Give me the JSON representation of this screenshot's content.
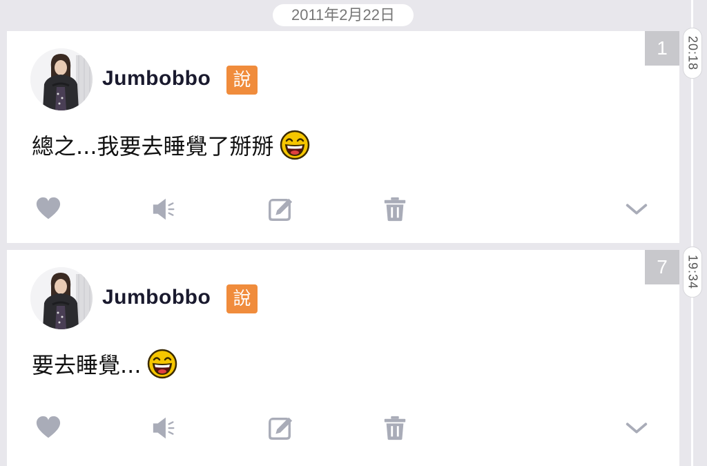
{
  "date_label": "2011年2月22日",
  "posts": [
    {
      "time": "20:18",
      "response_count": "1",
      "username": "Jumbobbo",
      "qualifier": "說",
      "text": "總之...我要去睡覺了掰掰",
      "emoji_icon": "grinning-face-emoji",
      "actions": [
        "heart-icon",
        "mute-icon",
        "edit-icon",
        "trash-icon",
        "chevron-down-icon"
      ]
    },
    {
      "time": "19:34",
      "response_count": "7",
      "username": "Jumbobbo",
      "qualifier": "說",
      "text": "要去睡覺...",
      "emoji_icon": "grinning-face-emoji",
      "actions": [
        "heart-icon",
        "mute-icon",
        "edit-icon",
        "trash-icon",
        "chevron-down-icon"
      ]
    }
  ],
  "colors": {
    "background": "#e8e7ec",
    "card": "#ffffff",
    "qualifier_badge": "#f08c3c",
    "count_badge": "#c8c8cc",
    "action_icon": "#a9acb8"
  }
}
